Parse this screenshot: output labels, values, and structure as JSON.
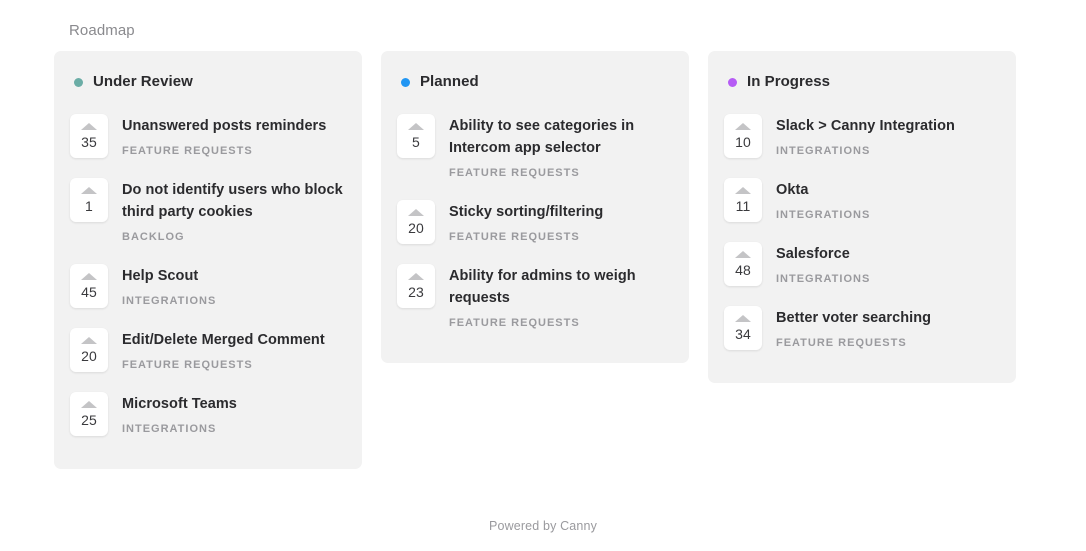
{
  "page": {
    "title": "Roadmap"
  },
  "footer": {
    "powered_by": "Powered by Canny"
  },
  "icons": {
    "vote_arrow": "upvote-arrow-icon",
    "status_dot": "status-dot-icon"
  },
  "columns": [
    {
      "title": "Under Review",
      "dot_color": "#6bada6",
      "posts": [
        {
          "votes": "35",
          "title": "Unanswered posts reminders",
          "category": "Feature Requests"
        },
        {
          "votes": "1",
          "title": "Do not identify users who block third party cookies",
          "category": "Backlog"
        },
        {
          "votes": "45",
          "title": "Help Scout",
          "category": "Integrations"
        },
        {
          "votes": "20",
          "title": "Edit/Delete Merged Comment",
          "category": "Feature Requests"
        },
        {
          "votes": "25",
          "title": "Microsoft Teams",
          "category": "Integrations"
        }
      ]
    },
    {
      "title": "Planned",
      "dot_color": "#2196f3",
      "posts": [
        {
          "votes": "5",
          "title": "Ability to see categories in Intercom app selector",
          "category": "Feature Requests"
        },
        {
          "votes": "20",
          "title": "Sticky sorting/filtering",
          "category": "Feature Requests"
        },
        {
          "votes": "23",
          "title": "Ability for admins to weigh requests",
          "category": "Feature Requests"
        }
      ]
    },
    {
      "title": "In Progress",
      "dot_color": "#b65cf5",
      "posts": [
        {
          "votes": "10",
          "title": "Slack > Canny Integration",
          "category": "Integrations"
        },
        {
          "votes": "11",
          "title": "Okta",
          "category": "Integrations"
        },
        {
          "votes": "48",
          "title": "Salesforce",
          "category": "Integrations"
        },
        {
          "votes": "34",
          "title": "Better voter searching",
          "category": "Feature Requests"
        }
      ]
    }
  ]
}
